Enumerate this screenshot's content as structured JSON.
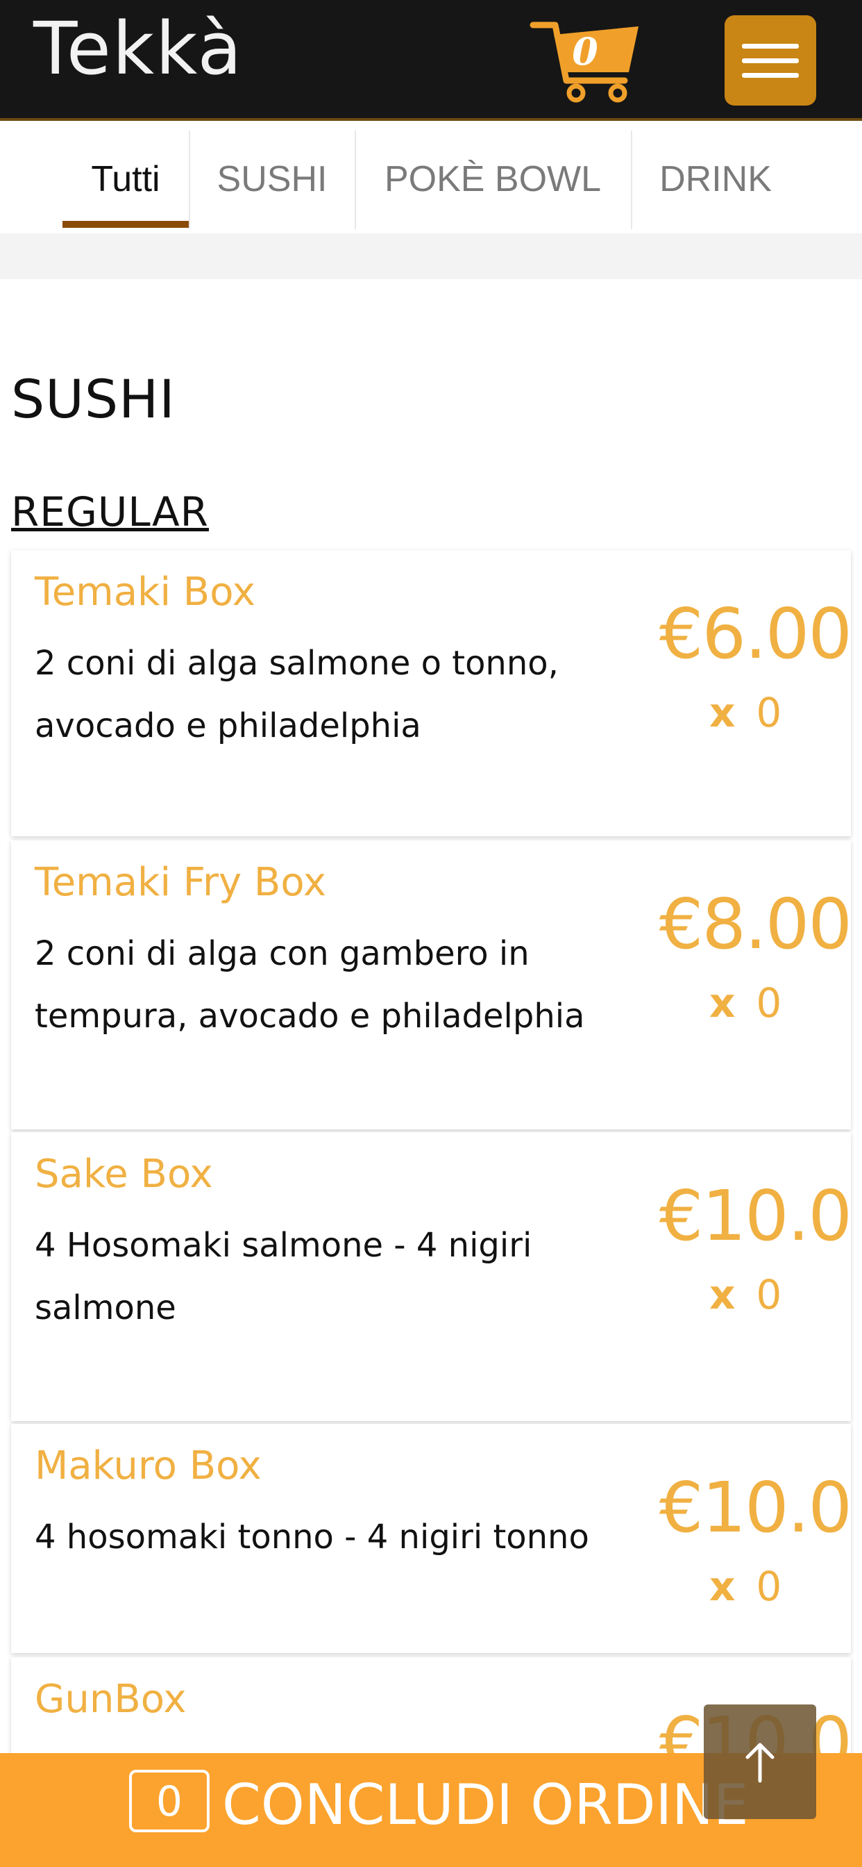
{
  "header": {
    "logo_text": "Tekkà",
    "cart_count": "0",
    "cart_icon": "shopping-cart-icon",
    "menu_icon": "hamburger-menu-icon",
    "colors": {
      "header_bg": "#161616",
      "accent": "#c98614"
    }
  },
  "tabs": [
    {
      "label": "Tutti",
      "active": true
    },
    {
      "label": "SUSHI",
      "active": false
    },
    {
      "label": "POKÈ BOWL",
      "active": false
    },
    {
      "label": "DRINK",
      "active": false
    }
  ],
  "section": {
    "title": "SUSHI",
    "subsection": "REGULAR"
  },
  "items": [
    {
      "name": "Temaki Box",
      "desc": "2 coni di alga salmone o tonno, avocado e philadelphia",
      "price": "€6.00",
      "qty_x": "x",
      "qty": "0"
    },
    {
      "name": "Temaki Fry Box",
      "desc": "2 coni di alga con gambero in tempura, avocado e philadelphia",
      "price": "€8.00",
      "qty_x": "x",
      "qty": "0"
    },
    {
      "name": "Sake Box",
      "desc": "4 Hosomaki salmone - 4 nigiri salmone",
      "price": "€10.0",
      "qty_x": "x",
      "qty": "0"
    },
    {
      "name": "Makuro Box",
      "desc": "4 hosomaki tonno - 4 nigiri tonno",
      "price": "€10.0",
      "qty_x": "x",
      "qty": "0"
    },
    {
      "name": "GunBox",
      "desc": "",
      "price": "€10.0",
      "qty_x": "",
      "qty": ""
    }
  ],
  "order_bar": {
    "count": "0",
    "label": "CONCLUDI ORDINE",
    "color": "#fba32e"
  },
  "scroll_top_icon": "arrow-up-icon"
}
